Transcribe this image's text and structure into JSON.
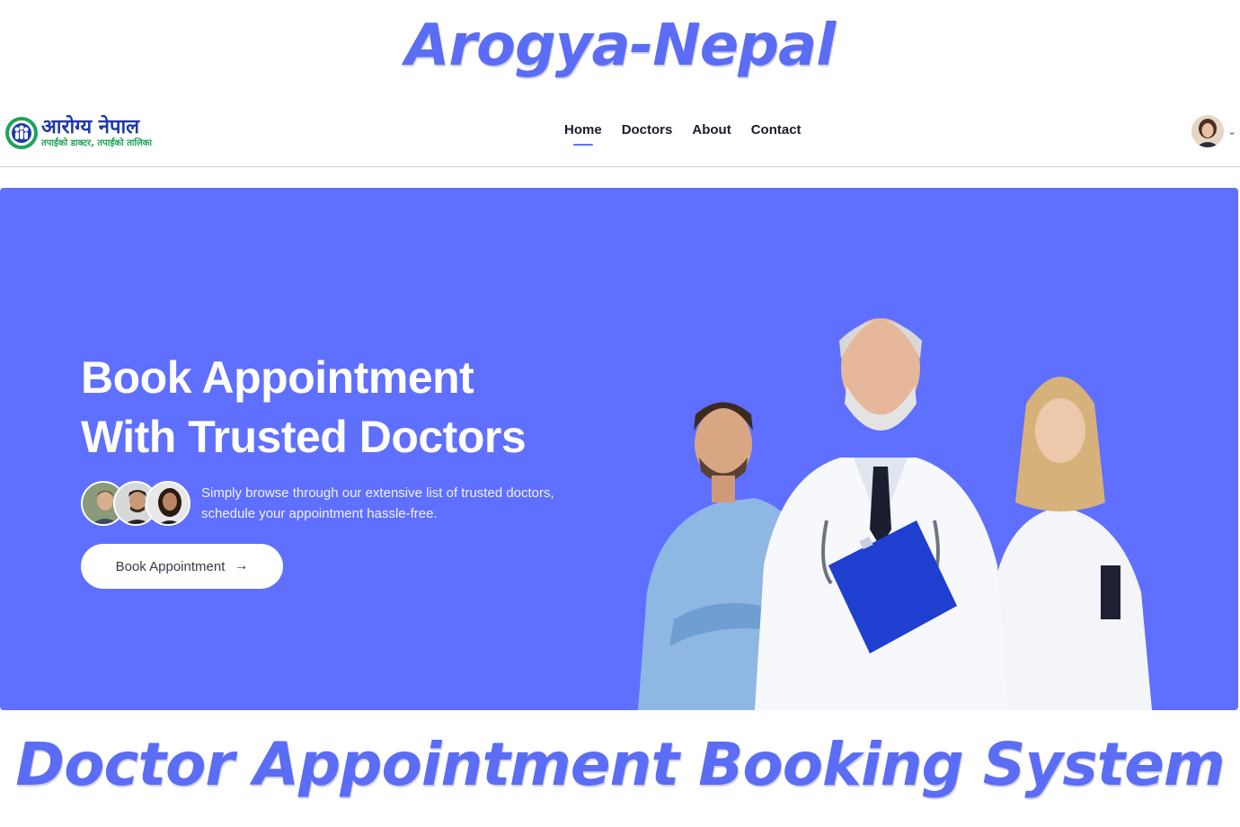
{
  "banner": {
    "top_title": "Arogya-Nepal",
    "bottom_title": "Doctor Appointment Booking System"
  },
  "navbar": {
    "logo_title": "आरोग्य नेपाल",
    "logo_tagline": "तपाईंको डाक्टर, तपाईंको तालिका",
    "links": [
      {
        "label": "Home",
        "active": true
      },
      {
        "label": "Doctors",
        "active": false
      },
      {
        "label": "About",
        "active": false
      },
      {
        "label": "Contact",
        "active": false
      }
    ],
    "profile_chevron": "⌄"
  },
  "hero": {
    "heading_line1": "Book Appointment",
    "heading_line2": "With Trusted Doctors",
    "description": "Simply browse through our extensive list of trusted doctors, schedule your appointment hassle-free.",
    "cta_label": "Book Appointment",
    "cta_icon": "→"
  },
  "colors": {
    "accent": "#5f6fff",
    "banner_text": "#5b6cf5",
    "logo_blue": "#1f3aa8",
    "logo_green": "#1ea35a"
  },
  "icons": [
    "logo-mark-icon",
    "chevron-down-icon",
    "arrow-right-icon"
  ]
}
